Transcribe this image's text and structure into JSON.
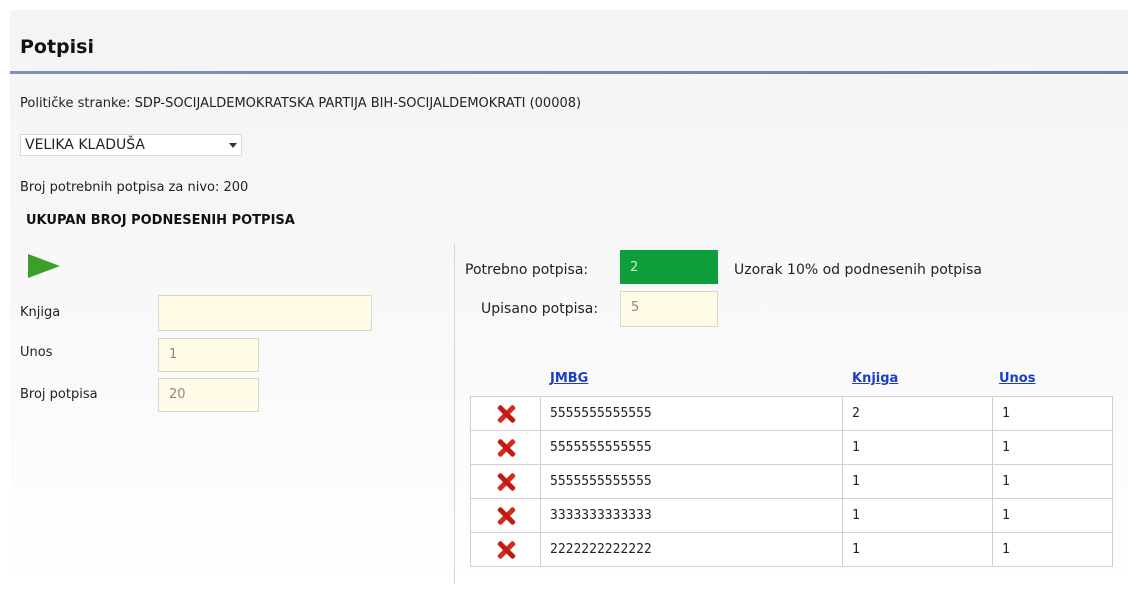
{
  "page": {
    "title": "Potpisi"
  },
  "party": {
    "line": "Političke stranke: SDP-SOCIJALDEMOKRATSKA PARTIJA BIH-SOCIJALDEMOKRATI (00008)"
  },
  "municipality_select": {
    "value": "VELIKA KLADUŠA"
  },
  "required_line": "Broj potrebnih potpisa za nivo: 200",
  "section_heading": "UKUPAN BROJ PODNESENIH POTPISA",
  "form": {
    "knjiga_label": "Knjiga",
    "knjiga_value": "",
    "unos_label": "Unos",
    "unos_value": "1",
    "broj_label": "Broj potpisa",
    "broj_value": "20"
  },
  "sample": {
    "potrebno_label": "Potrebno potpisa:",
    "potrebno_value": "2",
    "upisano_label": "Upisano potpisa:",
    "upisano_value": "5",
    "note": "Uzorak 10% od podnesenih potpisa"
  },
  "table": {
    "columns": [
      "JMBG",
      "Knjiga",
      "Unos"
    ],
    "rows": [
      {
        "jmbg": "5555555555555",
        "knjiga": "2",
        "unos": "1"
      },
      {
        "jmbg": "5555555555555",
        "knjiga": "1",
        "unos": "1"
      },
      {
        "jmbg": "5555555555555",
        "knjiga": "1",
        "unos": "1"
      },
      {
        "jmbg": "3333333333333",
        "knjiga": "1",
        "unos": "1"
      },
      {
        "jmbg": "2222222222222",
        "knjiga": "1",
        "unos": "1"
      }
    ]
  },
  "icons": {
    "play": "play-icon",
    "delete": "delete-x-icon",
    "dropdown": "chevron-down-icon"
  },
  "colors": {
    "accent_rule": "#7f93b5",
    "green": "#0f9e3c",
    "link": "#1a3fc4",
    "delete": "#d42a1e"
  }
}
